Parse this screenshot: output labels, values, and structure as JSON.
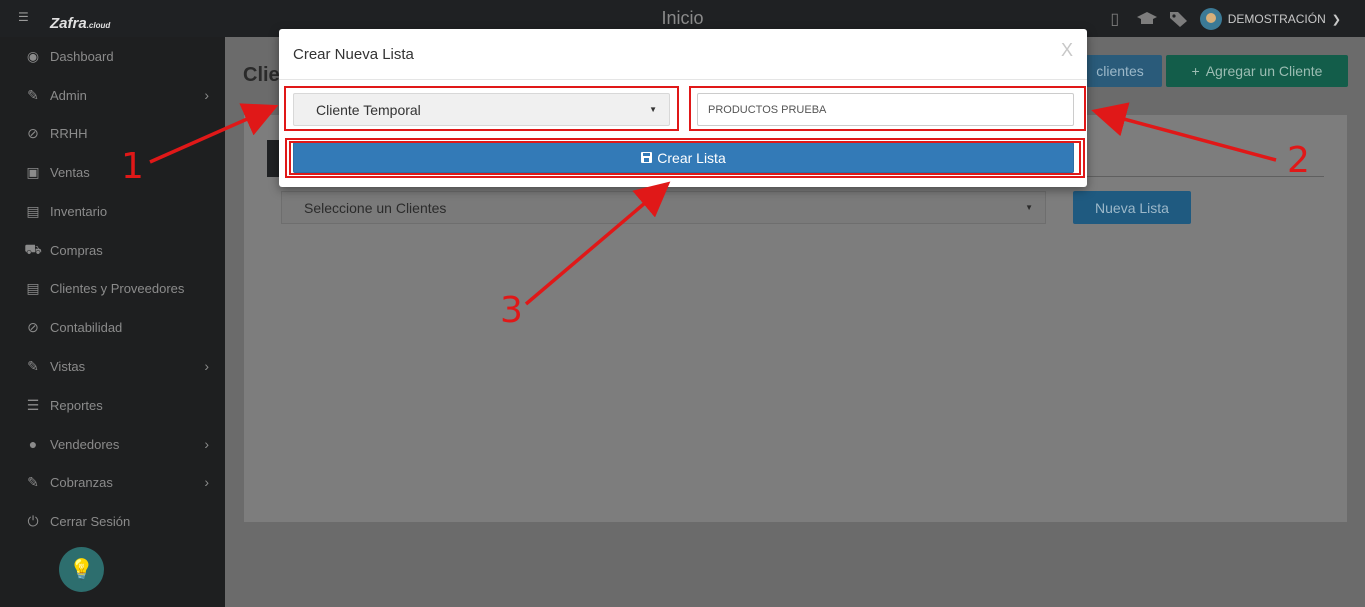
{
  "topbar": {
    "title": "Inicio",
    "logo": "Zafra",
    "logo_suffix": ".cloud",
    "user": "DEMOSTRACIÓN",
    "icons": [
      "mobile-icon",
      "graduation-cap-icon",
      "tags-icon"
    ]
  },
  "sidebar": {
    "items": [
      {
        "label": "Dashboard",
        "icon": "dashboard-icon",
        "has_submenu": false
      },
      {
        "label": "Admin",
        "icon": "wrench-icon",
        "has_submenu": true
      },
      {
        "label": "RRHH",
        "icon": "paperclip-icon",
        "has_submenu": false
      },
      {
        "label": "Ventas",
        "icon": "money-icon",
        "has_submenu": false
      },
      {
        "label": "Inventario",
        "icon": "book-icon",
        "has_submenu": false
      },
      {
        "label": "Compras",
        "icon": "cart-icon",
        "has_submenu": false
      },
      {
        "label": "Clientes y Proveedores",
        "icon": "book-icon",
        "has_submenu": false
      },
      {
        "label": "Contabilidad",
        "icon": "paperclip-icon",
        "has_submenu": false
      },
      {
        "label": "Vistas",
        "icon": "edit-icon",
        "has_submenu": true
      },
      {
        "label": "Reportes",
        "icon": "list-icon",
        "has_submenu": false
      },
      {
        "label": "Vendedores",
        "icon": "user-icon",
        "has_submenu": true
      },
      {
        "label": "Cobranzas",
        "icon": "edit-icon",
        "has_submenu": true
      },
      {
        "label": "Cerrar Sesión",
        "icon": "power-icon",
        "has_submenu": false
      }
    ]
  },
  "main": {
    "page_title": "Clie",
    "clientes_button": "clientes",
    "add_client_button": "Agregar un Cliente",
    "select_placeholder": "Seleccione un Clientes",
    "nueva_lista_button": "Nueva Lista"
  },
  "modal": {
    "title": "Crear Nueva Lista",
    "close": "X",
    "client_select_value": "Cliente Temporal",
    "list_name_value": "PRODUCTOS PRUEBA",
    "create_button": "Crear Lista"
  },
  "annotations": {
    "labels": [
      "1",
      "2",
      "3"
    ],
    "color": "#e01818"
  }
}
